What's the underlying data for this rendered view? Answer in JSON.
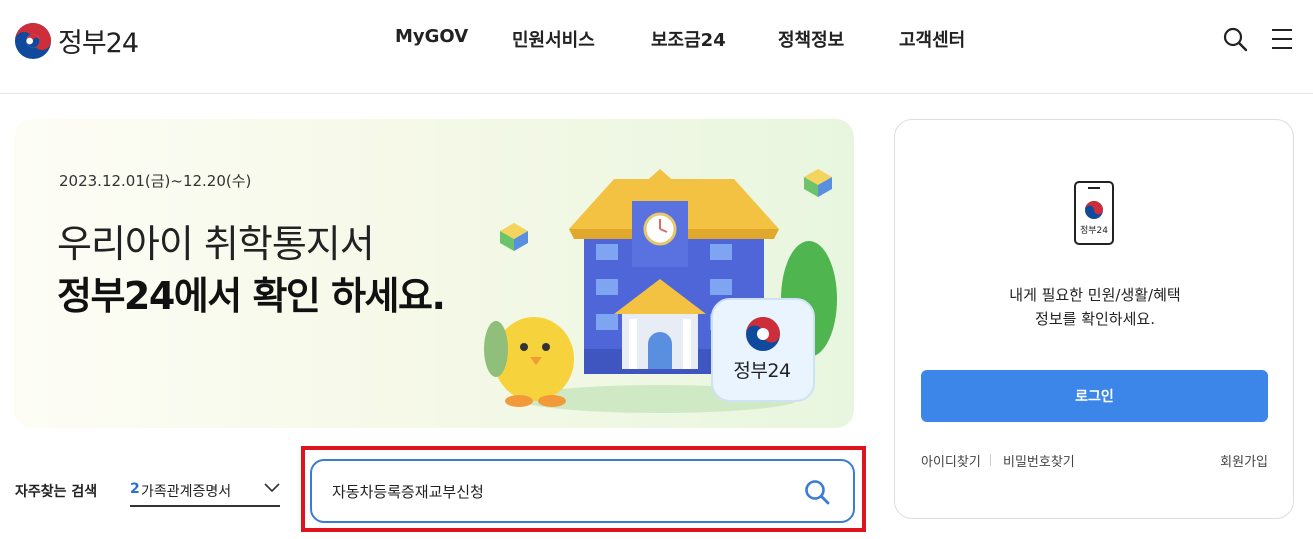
{
  "header": {
    "logo_text": "정부24",
    "nav": [
      "MyGOV",
      "민원서비스",
      "보조금24",
      "정책정보",
      "고객센터"
    ],
    "search_icon": "search-icon",
    "menu_icon": "hamburger-menu-icon"
  },
  "banner": {
    "date": "2023.12.01(금)~12.20(수)",
    "title_line1": "우리아이 취학통지서",
    "title_line2": "정부24에서 확인 하세요.",
    "badge_text": "정부24"
  },
  "quick_search": {
    "label": "자주찾는 검색",
    "rank": "2",
    "selected": "가족관계증명서",
    "chevron_icon": "chevron-down-icon"
  },
  "search": {
    "value": "자동차등록증재교부신청",
    "button_icon": "search-icon"
  },
  "login_card": {
    "phone_label": "정부24",
    "message_line1": "내게 필요한 민원/생활/혜택",
    "message_line2": "정보를 확인하세요.",
    "login_button": "로그인",
    "find_id": "아이디찾기",
    "find_password": "비밀번호찾기",
    "signup": "회원가입"
  },
  "colors": {
    "accent": "#3b86e8",
    "highlight": "#e0141e",
    "taegeuk_red": "#cd2e3a",
    "taegeuk_blue": "#0f4a9c"
  }
}
